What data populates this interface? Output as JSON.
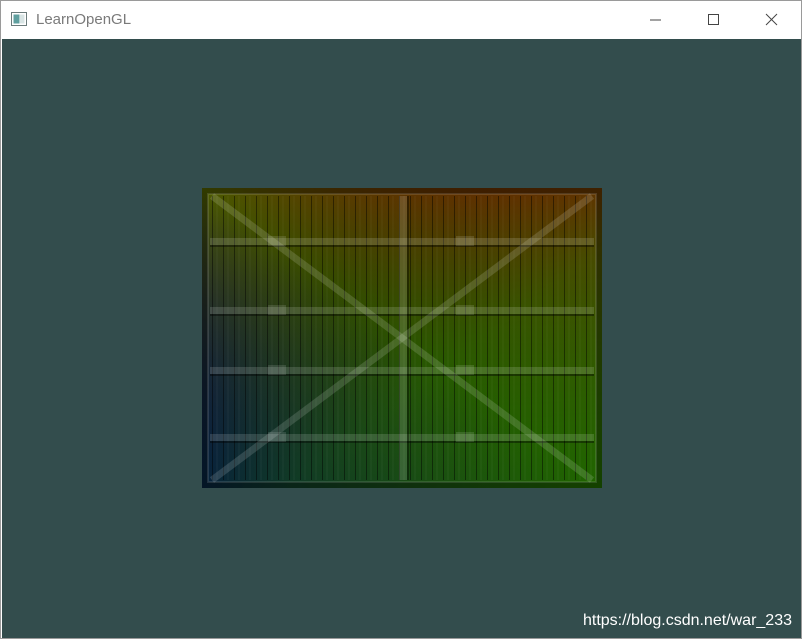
{
  "window": {
    "title": "LearnOpenGL",
    "icon": "app-window-icon",
    "controls": {
      "minimize_icon": "minimize-icon",
      "maximize_icon": "maximize-icon",
      "close_icon": "close-icon"
    }
  },
  "viewport": {
    "clear_color": "#334d4d",
    "quad": {
      "texture": "wooden-container-texture",
      "vertex_colors": {
        "top_right": "#ff0000",
        "center": "#808000",
        "bottom_right": "#00ff00",
        "bottom_left": "#0000ff"
      }
    }
  },
  "watermark": {
    "text": "https://blog.csdn.net/war_233"
  }
}
